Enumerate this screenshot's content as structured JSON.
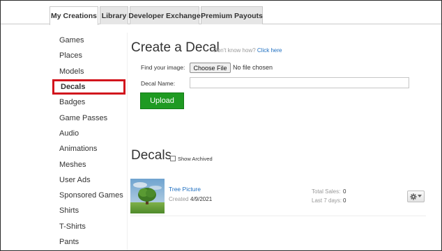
{
  "tabs": [
    {
      "label": "My Creations",
      "active": true
    },
    {
      "label": "Library",
      "active": false
    },
    {
      "label": "Developer Exchange",
      "active": false
    },
    {
      "label": "Premium Payouts",
      "active": false
    }
  ],
  "sidebar": {
    "items": [
      {
        "label": "Games"
      },
      {
        "label": "Places"
      },
      {
        "label": "Models"
      },
      {
        "label": "Decals",
        "active": true
      },
      {
        "label": "Badges"
      },
      {
        "label": "Game Passes"
      },
      {
        "label": "Audio"
      },
      {
        "label": "Animations"
      },
      {
        "label": "Meshes"
      },
      {
        "label": "User Ads"
      },
      {
        "label": "Sponsored Games"
      },
      {
        "label": "Shirts"
      },
      {
        "label": "T-Shirts"
      },
      {
        "label": "Pants"
      }
    ],
    "highlight_color": "#d2141d"
  },
  "create": {
    "title": "Create a Decal",
    "help_prefix": "Don't know how?",
    "help_link": "Click here",
    "find_label": "Find your image:",
    "choose_file_label": "Choose File",
    "no_file_text": "No file chosen",
    "name_label": "Decal Name:",
    "name_value": "",
    "upload_label": "Upload",
    "upload_color": "#1f9a22"
  },
  "decals": {
    "title": "Decals",
    "show_archived_label": "Show Archived",
    "show_archived_checked": false,
    "items": [
      {
        "name": "Tree Picture",
        "created_label": "Created",
        "created": "4/9/2021",
        "total_sales_label": "Total Sales:",
        "total_sales": "0",
        "last7_label": "Last 7 days:",
        "last7": "0",
        "thumbnail_icon": "tree-image",
        "menu_icon": "gear-icon"
      }
    ]
  },
  "link_color": "#1d6ec0"
}
